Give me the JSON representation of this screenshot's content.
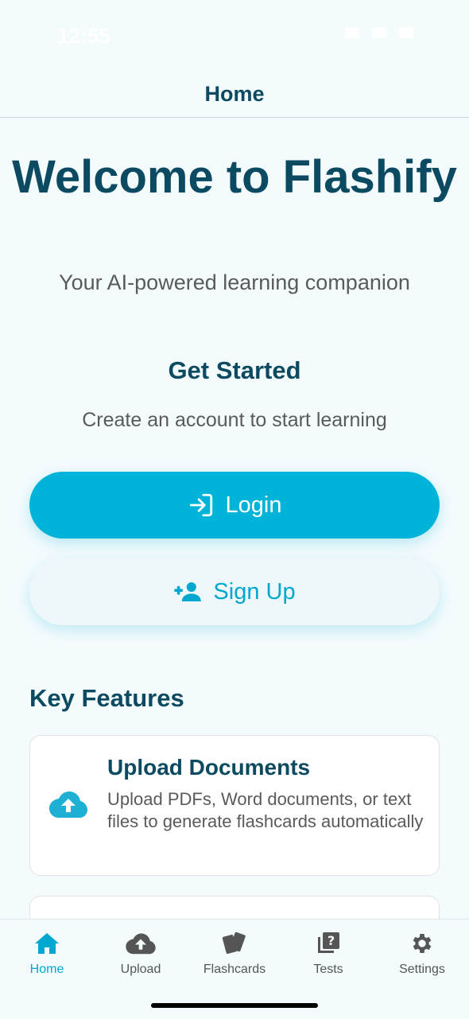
{
  "status_bar": {
    "time": "12:55"
  },
  "header": {
    "title": "Home"
  },
  "hero": {
    "title": "Welcome to Flashify",
    "tagline": "Your AI-powered learning companion"
  },
  "get_started": {
    "title": "Get Started",
    "subtitle": "Create an account to start learning",
    "login_label": "Login",
    "signup_label": "Sign Up"
  },
  "features": {
    "title": "Key Features",
    "items": [
      {
        "icon": "cloud-upload-icon",
        "title": "Upload Documents",
        "description": "Upload PDFs, Word documents, or text files to generate flashcards automatically"
      }
    ]
  },
  "tabbar": {
    "items": [
      {
        "label": "Home",
        "icon": "home-icon",
        "active": true
      },
      {
        "label": "Upload",
        "icon": "cloud-upload-icon",
        "active": false
      },
      {
        "label": "Flashcards",
        "icon": "cards-icon",
        "active": false
      },
      {
        "label": "Tests",
        "icon": "quiz-icon",
        "active": false
      },
      {
        "label": "Settings",
        "icon": "gear-icon",
        "active": false
      }
    ]
  },
  "colors": {
    "accent": "#00b3d9",
    "heading": "#0b4a60",
    "background": "#f4fbfd",
    "muted_text": "#5a5a5a"
  }
}
